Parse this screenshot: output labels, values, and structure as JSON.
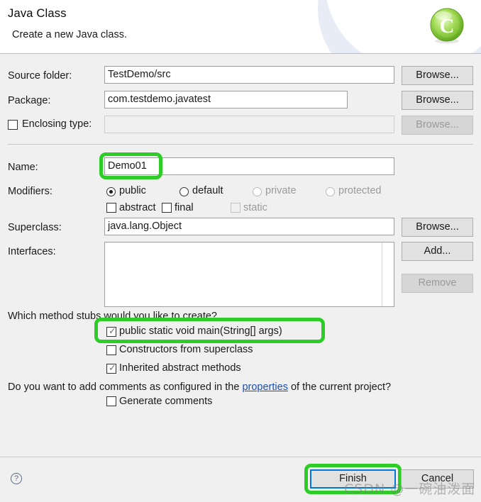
{
  "header": {
    "title": "Java Class",
    "subtitle": "Create a new Java class.",
    "icon": "java-class-icon"
  },
  "fields": {
    "source_folder": {
      "label": "Source folder:",
      "value": "TestDemo/src",
      "browse_label": "Browse..."
    },
    "package": {
      "label": "Package:",
      "value": "com.testdemo.javatest",
      "browse_label": "Browse..."
    },
    "enclosing_type": {
      "label": "Enclosing type:",
      "value": "",
      "checked": false,
      "enabled": false,
      "browse_label": "Browse..."
    },
    "name": {
      "label": "Name:",
      "value": "Demo01"
    },
    "superclass": {
      "label": "Superclass:",
      "value": "java.lang.Object",
      "browse_label": "Browse..."
    },
    "interfaces": {
      "label": "Interfaces:",
      "items": [],
      "add_label": "Add...",
      "remove_label": "Remove"
    }
  },
  "modifiers": {
    "label": "Modifiers:",
    "access": [
      {
        "label": "public",
        "selected": true,
        "enabled": true
      },
      {
        "label": "default",
        "selected": false,
        "enabled": true
      },
      {
        "label": "private",
        "selected": false,
        "enabled": false
      },
      {
        "label": "protected",
        "selected": false,
        "enabled": false
      }
    ],
    "flags": [
      {
        "label": "abstract",
        "checked": false,
        "enabled": true
      },
      {
        "label": "final",
        "checked": false,
        "enabled": true
      },
      {
        "label": "static",
        "checked": false,
        "enabled": false
      }
    ]
  },
  "stubs": {
    "question": "Which method stubs would you like to create?",
    "options": [
      {
        "label": "public static void main(String[] args)",
        "checked": true
      },
      {
        "label": "Constructors from superclass",
        "checked": false
      },
      {
        "label": "Inherited abstract methods",
        "checked": true
      }
    ]
  },
  "comments": {
    "question_prefix": "Do you want to add comments as configured in the ",
    "link_label": "properties",
    "question_suffix": " of the current project?",
    "option": {
      "label": "Generate comments",
      "checked": false
    }
  },
  "footer": {
    "help_label": "?",
    "finish_label": "Finish",
    "cancel_label": "Cancel"
  },
  "watermark": "CSDN @一碗油泼面",
  "colors": {
    "annotation": "#2ecc27",
    "focus": "#0078d7",
    "link": "#1a4fba",
    "window": "#f0f0f0"
  }
}
